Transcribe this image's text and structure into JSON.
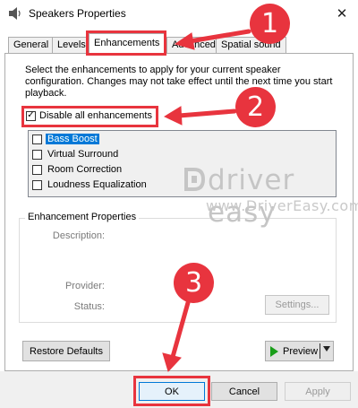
{
  "window": {
    "title": "Speakers Properties",
    "close_glyph": "✕"
  },
  "tabs": [
    {
      "label": "General"
    },
    {
      "label": "Levels"
    },
    {
      "label": "Enhancements",
      "active": true
    },
    {
      "label": "Advanced"
    },
    {
      "label": "Spatial sound"
    }
  ],
  "enhancements": {
    "description": "Select the enhancements to apply for your current speaker configuration. Changes may not take effect until the next time you start playback.",
    "disable_all": {
      "label": "Disable all enhancements",
      "checked": true,
      "check_glyph": "✓"
    },
    "items": [
      {
        "label": "Bass Boost",
        "checked": false,
        "selected": true
      },
      {
        "label": "Virtual Surround",
        "checked": false
      },
      {
        "label": "Room Correction",
        "checked": false
      },
      {
        "label": "Loudness Equalization",
        "checked": false
      }
    ]
  },
  "properties": {
    "title": "Enhancement Properties",
    "description_label": "Description:",
    "provider_label": "Provider:",
    "status_label": "Status:",
    "settings_button": "Settings..."
  },
  "buttons": {
    "restore_defaults": "Restore Defaults",
    "preview": "Preview",
    "ok": "OK",
    "cancel": "Cancel",
    "apply": "Apply"
  },
  "watermark": {
    "brand": "driver easy",
    "url": "www.DriverEasy.com"
  },
  "annotations": {
    "step1": "1",
    "step2": "2",
    "step3": "3",
    "color": "#e8343e"
  },
  "colors": {
    "selection": "#0078d7",
    "preview_play": "#1a9e1a"
  }
}
